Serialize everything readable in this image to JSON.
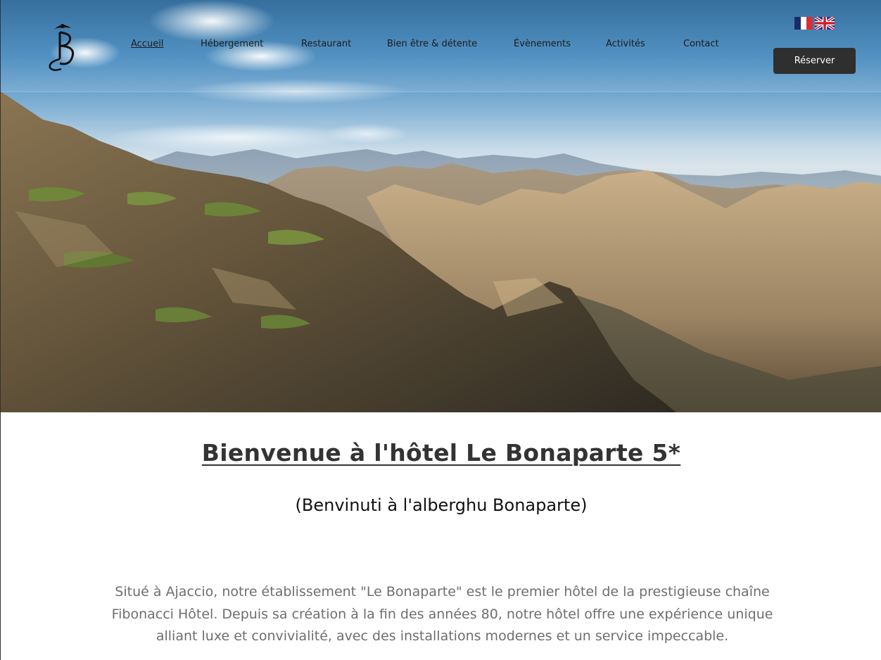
{
  "header": {
    "logo_alt": "B",
    "nav": [
      {
        "label": "Accueil",
        "active": true
      },
      {
        "label": "Hébergement",
        "active": false
      },
      {
        "label": "Restaurant",
        "active": false
      },
      {
        "label": "Bien être & détente",
        "active": false
      },
      {
        "label": "Évènements",
        "active": false
      },
      {
        "label": "Activités",
        "active": false
      },
      {
        "label": "Contact",
        "active": false
      }
    ],
    "languages": [
      {
        "code": "fr",
        "icon": "french-flag-icon"
      },
      {
        "code": "en",
        "icon": "uk-flag-icon"
      }
    ],
    "reserve_label": "Réserver"
  },
  "hero": {
    "image": "mountain-landscape"
  },
  "welcome": {
    "title": "Bienvenue à l'hôtel Le Bonaparte 5*",
    "subtitle": "(Benvinuti à l'alberghu Bonaparte)",
    "intro": "Situé à Ajaccio, notre établissement \"Le Bonaparte\" est le premier hôtel de la prestigieuse chaîne Fibonacci Hôtel. Depuis sa création à la fin des années 80, notre hôtel offre une expérience unique alliant luxe et convivialité, avec des installations modernes et un service impeccable."
  },
  "colors": {
    "button_bg": "#2f2f2f",
    "title_text": "#333333",
    "intro_text": "#6e6e6e",
    "sky_top": "#1f5f93"
  }
}
